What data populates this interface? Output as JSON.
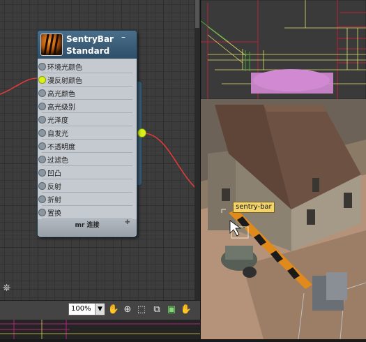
{
  "node": {
    "title_line1": "SentryBar",
    "title_line2": "Standard",
    "collapse_glyph": "–",
    "slots": [
      {
        "label": "环境光颜色",
        "active": false
      },
      {
        "label": "漫反射颜色",
        "active": true
      },
      {
        "label": "高光颜色",
        "active": false
      },
      {
        "label": "高光级别",
        "active": false
      },
      {
        "label": "光泽度",
        "active": false
      },
      {
        "label": "自发光",
        "active": false
      },
      {
        "label": "不透明度",
        "active": false
      },
      {
        "label": "过滤色",
        "active": false
      },
      {
        "label": "凹凸",
        "active": false
      },
      {
        "label": "反射",
        "active": false
      },
      {
        "label": "折射",
        "active": false
      },
      {
        "label": "置换",
        "active": false
      }
    ],
    "footer_label": "mr 连接",
    "expand_glyph": "✚"
  },
  "toolbar": {
    "zoom_value": "100%",
    "zoom_arrow": "▼",
    "binocular_glyph": "⛯",
    "tools": [
      {
        "name": "pan-hand-icon",
        "glyph": "✋"
      },
      {
        "name": "zoom-icon",
        "glyph": "⊕"
      },
      {
        "name": "zoom-region-icon",
        "glyph": "⬚"
      },
      {
        "name": "frame-selected-icon",
        "glyph": "⧉"
      },
      {
        "name": "frame-all-icon",
        "glyph": "▣"
      },
      {
        "name": "pan-view-icon",
        "glyph": "✋"
      }
    ]
  },
  "viewport": {
    "tooltip": "sentry-bar"
  },
  "colors": {
    "wire": "#e23a3a",
    "slot_active": "#d9f21b",
    "node_header": "#2e4f69",
    "tooltip_bg": "#f3d36c",
    "selection_wire": "#f0e8d0"
  }
}
